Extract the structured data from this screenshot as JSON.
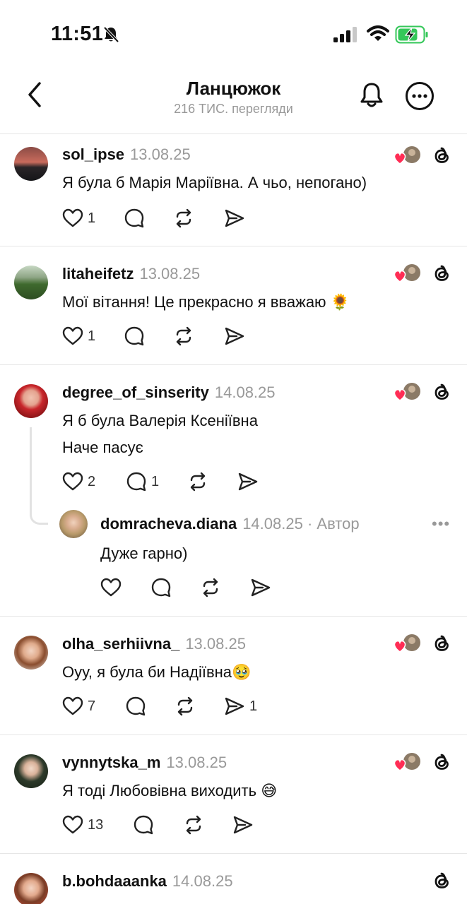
{
  "status_bar": {
    "time": "11:51"
  },
  "header": {
    "title": "Ланцюжок",
    "subtitle": "216 ТИС. перегляди"
  },
  "posts": [
    {
      "username": "sol_ipse",
      "date": "13.08.25",
      "lines": [
        "Я була б Марія Маріївна. А чьо, непогано)"
      ],
      "likes": "1",
      "replies": "",
      "reposts": "",
      "shares": ""
    },
    {
      "username": "litaheifetz",
      "date": "13.08.25",
      "lines": [
        "Мої вітання! Це прекрасно я вважаю 🌻"
      ],
      "likes": "1",
      "replies": "",
      "reposts": "",
      "shares": ""
    },
    {
      "username": "degree_of_sinserity",
      "date": "14.08.25",
      "lines": [
        "Я б була Валерія Ксеніївна",
        "Наче пасує"
      ],
      "likes": "2",
      "replies": "1",
      "reposts": "",
      "shares": "",
      "reply": {
        "username": "domracheva.diana",
        "date": "14.08.25",
        "author_label": "· Автор",
        "text": "Дуже гарно)"
      }
    },
    {
      "username": "olha_serhiivna_",
      "date": "13.08.25",
      "lines": [
        "Оуу, я була би Надіївна🥹"
      ],
      "likes": "7",
      "replies": "",
      "reposts": "",
      "shares": "1"
    },
    {
      "username": "vynnytska_m",
      "date": "13.08.25",
      "lines": [
        "Я тоді Любовівна виходить 😅"
      ],
      "likes": "13",
      "replies": "",
      "reposts": "",
      "shares": ""
    },
    {
      "username": "b.bohdaaanka",
      "date": "14.08.25",
      "lines": [],
      "likes": "",
      "replies": "",
      "reposts": "",
      "shares": ""
    }
  ],
  "colors": {
    "accent_heart": "#ff2d55",
    "muted": "#999999",
    "battery_green": "#34c759"
  }
}
